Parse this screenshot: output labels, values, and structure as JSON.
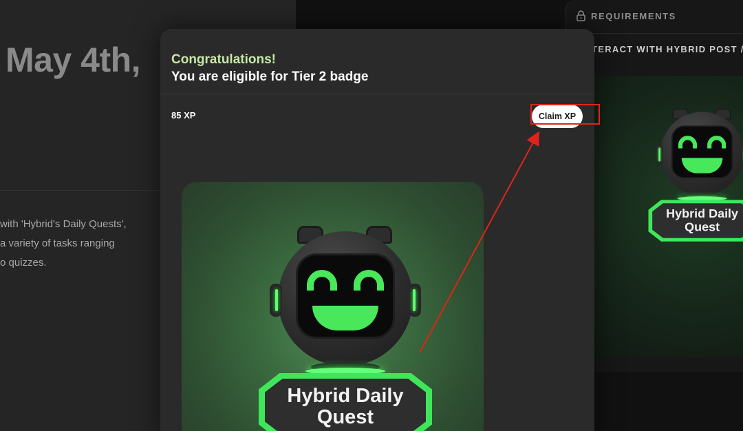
{
  "background": {
    "date_heading": "May 4th,",
    "description_lines": [
      "with 'Hybrid's Daily Quests',",
      "a variety of tasks ranging",
      "o quizzes."
    ]
  },
  "requirements": {
    "title": "REQUIREMENTS",
    "item": "TERACT WITH HYBRID POST  /",
    "image_text": "Hybrid Daily Quest"
  },
  "modal": {
    "congrats": "Congratulations!",
    "eligible": "You are eligible for Tier 2 badge",
    "xp": "85 XP",
    "claim_label": "Claim XP",
    "badge_text_line1": "Hybrid Daily",
    "badge_text_line2": "Quest"
  },
  "colors": {
    "accent_green": "#48e85a",
    "congrats_text": "#c7e7a6",
    "annotation_red": "#e0241b"
  }
}
